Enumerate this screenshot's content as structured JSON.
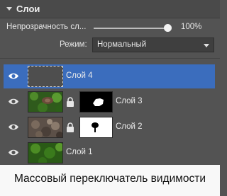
{
  "panel": {
    "title": "Слои"
  },
  "opacity": {
    "label": "Непрозрачность сл...",
    "value": "100%",
    "level": 1.0
  },
  "mode": {
    "label": "Режим:",
    "selected": "Нормальный"
  },
  "layers": [
    {
      "name": "Слой 4",
      "selected": true,
      "visible": true,
      "locked": false,
      "has_mask": false
    },
    {
      "name": "Слой 3",
      "selected": false,
      "visible": true,
      "locked": true,
      "has_mask": true
    },
    {
      "name": "Слой 2",
      "selected": false,
      "visible": true,
      "locked": true,
      "has_mask": true
    },
    {
      "name": "Слой 1",
      "selected": false,
      "visible": true,
      "locked": false,
      "has_mask": false
    }
  ],
  "overlay": {
    "caption": "Массовый переключатель видимости"
  },
  "colors": {
    "panel_bg": "#535353",
    "selection": "#3b6dbd",
    "text": "#e6e6e6"
  }
}
